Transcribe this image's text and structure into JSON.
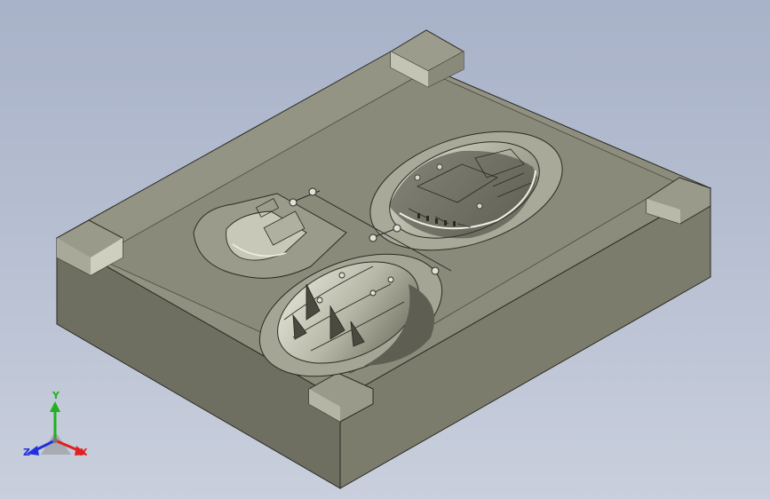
{
  "viewport": {
    "background_top": "#a8b2c8",
    "background_bottom": "#c9cfdc"
  },
  "model": {
    "base_color": "#8e8e7e",
    "top_face_color": "#8f8f7f",
    "front_face_color": "#6f6f61",
    "right_face_color": "#7c7c6d",
    "cavity_color": "#b6b6a6"
  },
  "triad": {
    "labels": {
      "x": "X",
      "y": "Y",
      "z": "Z"
    },
    "colors": {
      "x": "#e02020",
      "y": "#20b020",
      "z": "#2030e0"
    }
  }
}
